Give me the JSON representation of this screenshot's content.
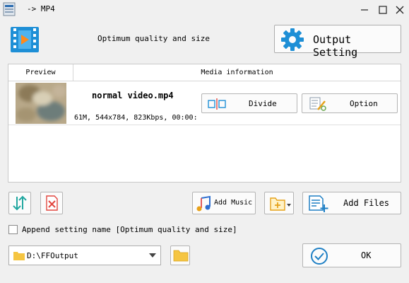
{
  "window": {
    "title": "-> MP4"
  },
  "header": {
    "quality_text": "Optimum quality and size",
    "output_setting_label": "Output Setting"
  },
  "table": {
    "columns": [
      "Preview",
      "Media information"
    ],
    "rows": [
      {
        "filename": "normal video.mp4",
        "details": "61M, 544x784, 823Kbps, 00:00:",
        "divide_label": "Divide",
        "option_label": "Option"
      }
    ]
  },
  "toolbar": {
    "add_music_label": "Add Music",
    "add_files_label": "Add Files"
  },
  "append": {
    "label": "Append setting name [Optimum quality and size]",
    "checked": false
  },
  "output": {
    "folder": "D:\\FFOutput",
    "ok_label": "OK"
  },
  "colors": {
    "accent_blue": "#1e8fd6",
    "teal": "#21a7a0",
    "remove_red": "#e2463f",
    "folder_yellow": "#f5c542"
  }
}
